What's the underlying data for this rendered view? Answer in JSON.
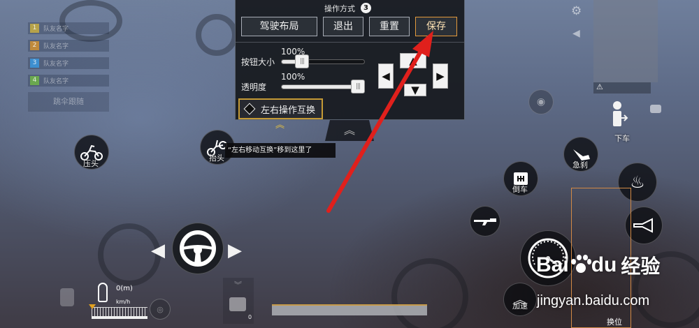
{
  "team": {
    "members": [
      {
        "num": "1",
        "name": "队友名字",
        "color": "#b6a24a"
      },
      {
        "num": "2",
        "name": "队友名字",
        "color": "#c08a3c"
      },
      {
        "num": "3",
        "name": "队友名字",
        "color": "#3d8fd0"
      },
      {
        "num": "4",
        "name": "队友名字",
        "color": "#6aa84f"
      }
    ],
    "parachute_follow": "跳伞跟随"
  },
  "panel": {
    "title": "操作方式",
    "badge": "3",
    "layout_button": "驾驶布局",
    "exit_button": "退出",
    "reset_button": "重置",
    "save_button": "保存",
    "size_label": "按钮大小",
    "size_value": "100%",
    "size_level": 0.2,
    "opacity_label": "透明度",
    "opacity_value": "100%",
    "opacity_level": 1.0,
    "swap_toggle": "左右操作互换",
    "collapse": "︽",
    "chevrons": "︽"
  },
  "tooltip": "“左右移动互换”移到这里了",
  "controls": {
    "press_head": "压头",
    "lift_head": "抬头",
    "brake": "急刹",
    "reverse": "倒车",
    "accelerate": "加速",
    "get_off": "下车",
    "swap_seat": "换位"
  },
  "hud": {
    "speed_value": "0(m)",
    "speed_unit": "km/h",
    "medkit_count": "0"
  },
  "watermark": {
    "brand": "Bai",
    "brand_tail": "du",
    "sub": "经验",
    "url": "jingyan.baidu.com"
  },
  "colors": {
    "accent_gold": "#c59a35",
    "save_border": "#e39a3c",
    "arrow_red": "#e0201c"
  }
}
